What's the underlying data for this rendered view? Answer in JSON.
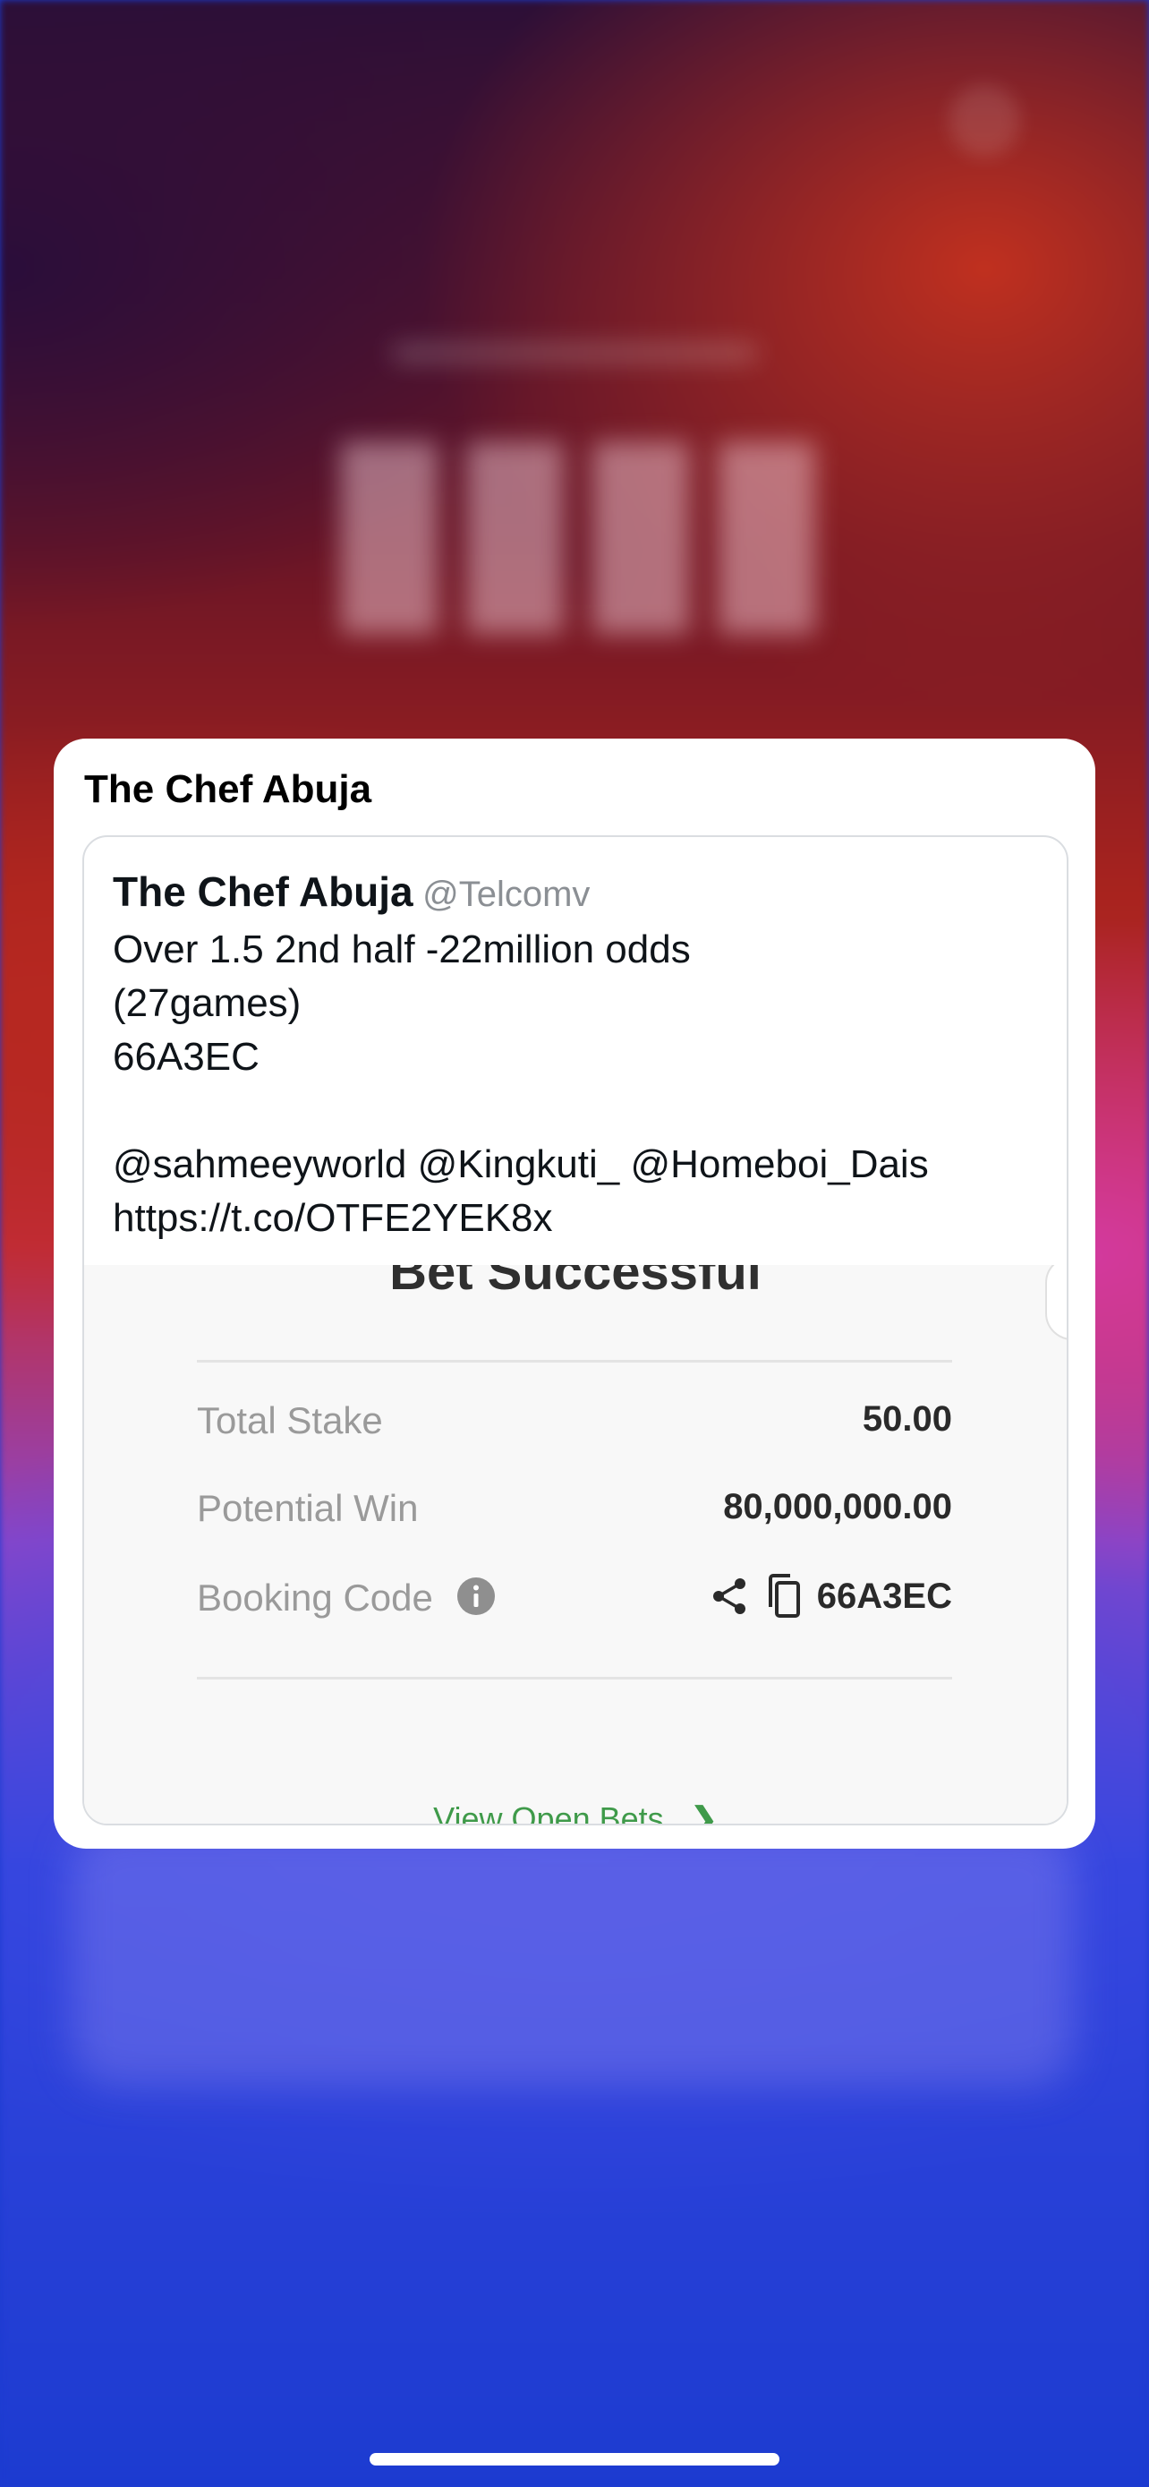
{
  "notification": {
    "title": "The Chef Abuja"
  },
  "tweet": {
    "name": "The Chef Abuja",
    "handle": "@Telcomv",
    "lines": [
      "Over 1.5 2nd half -22million odds",
      "(27games)",
      "66A3EC",
      "",
      "@sahmeeyworld @Kingkuti_  @Homeboi_Dais",
      "https://t.co/OTFE2YEK8x"
    ]
  },
  "bet_slip": {
    "title": "Bet Successful",
    "rows": {
      "total_stake": {
        "label": "Total Stake",
        "value": "50.00"
      },
      "potential_win": {
        "label": "Potential Win",
        "value": "80,000,000.00"
      },
      "booking_code": {
        "label": "Booking Code",
        "value": "66A3EC"
      }
    },
    "view_open_bets": "View Open Bets",
    "icons": [
      "info-icon",
      "share-icon",
      "copy-icon",
      "chevron-right-icon"
    ],
    "accent_color": "#3f9a4a"
  }
}
